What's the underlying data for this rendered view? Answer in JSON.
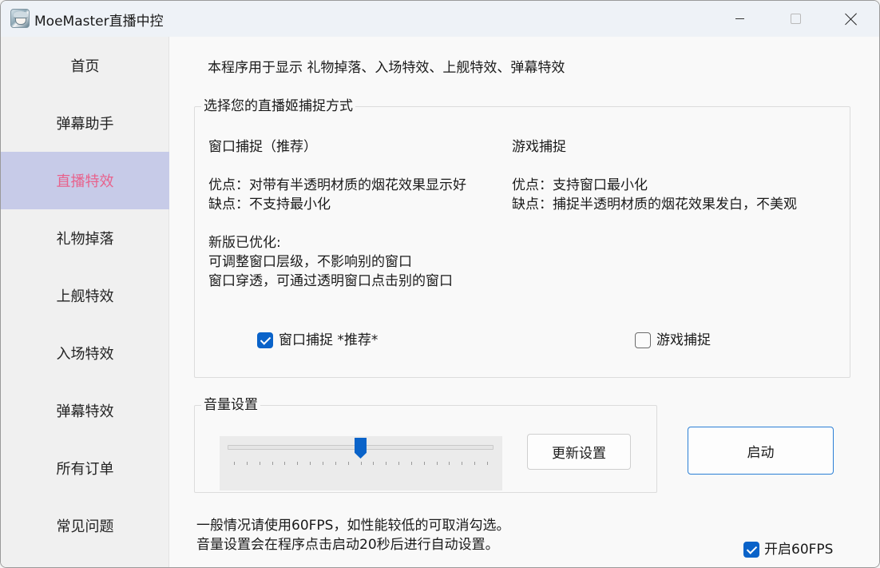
{
  "window": {
    "title": "MoeMaster直播中控"
  },
  "sidebar": {
    "items": [
      {
        "label": "首页"
      },
      {
        "label": "弹幕助手"
      },
      {
        "label": "直播特效"
      },
      {
        "label": "礼物掉落"
      },
      {
        "label": "上舰特效"
      },
      {
        "label": "入场特效"
      },
      {
        "label": "弹幕特效"
      },
      {
        "label": "所有订单"
      },
      {
        "label": "常见问题"
      }
    ],
    "active_index": 2
  },
  "main": {
    "description": "本程序用于显示 礼物掉落、入场特效、上舰特效、弹幕特效",
    "capture": {
      "legend": "选择您的直播姬捕捉方式",
      "window": {
        "title": "窗口捕捉（推荐）",
        "pros": "优点：对带有半透明材质的烟花效果显示好",
        "cons": "缺点：不支持最小化",
        "optimized_title": "新版已优化:",
        "optimized_1": "可调整窗口层级，不影响别的窗口",
        "optimized_2": "窗口穿透，可通过透明窗口点击别的窗口",
        "checkbox_label": "窗口捕捉 *推荐*",
        "checked": true
      },
      "game": {
        "title": "游戏捕捉",
        "pros": "优点：支持窗口最小化",
        "cons": "缺点：捕捉半透明材质的烟花效果发白，不美观",
        "checkbox_label": "游戏捕捉",
        "checked": false
      }
    },
    "volume": {
      "legend": "音量设置",
      "level": 0.5,
      "update_button": "更新设置"
    },
    "start_button": "启动",
    "notes": {
      "line1": "一般情况请使用60FPS，如性能较低的可取消勾选。",
      "line2": "音量设置会在程序点击启动20秒后进行自动设置。"
    },
    "fps": {
      "label": "开启60FPS",
      "checked": true
    }
  },
  "colors": {
    "accent": "#0a63c9",
    "active_nav_bg": "#c7cbe8",
    "active_nav_text": "#e8628c"
  }
}
